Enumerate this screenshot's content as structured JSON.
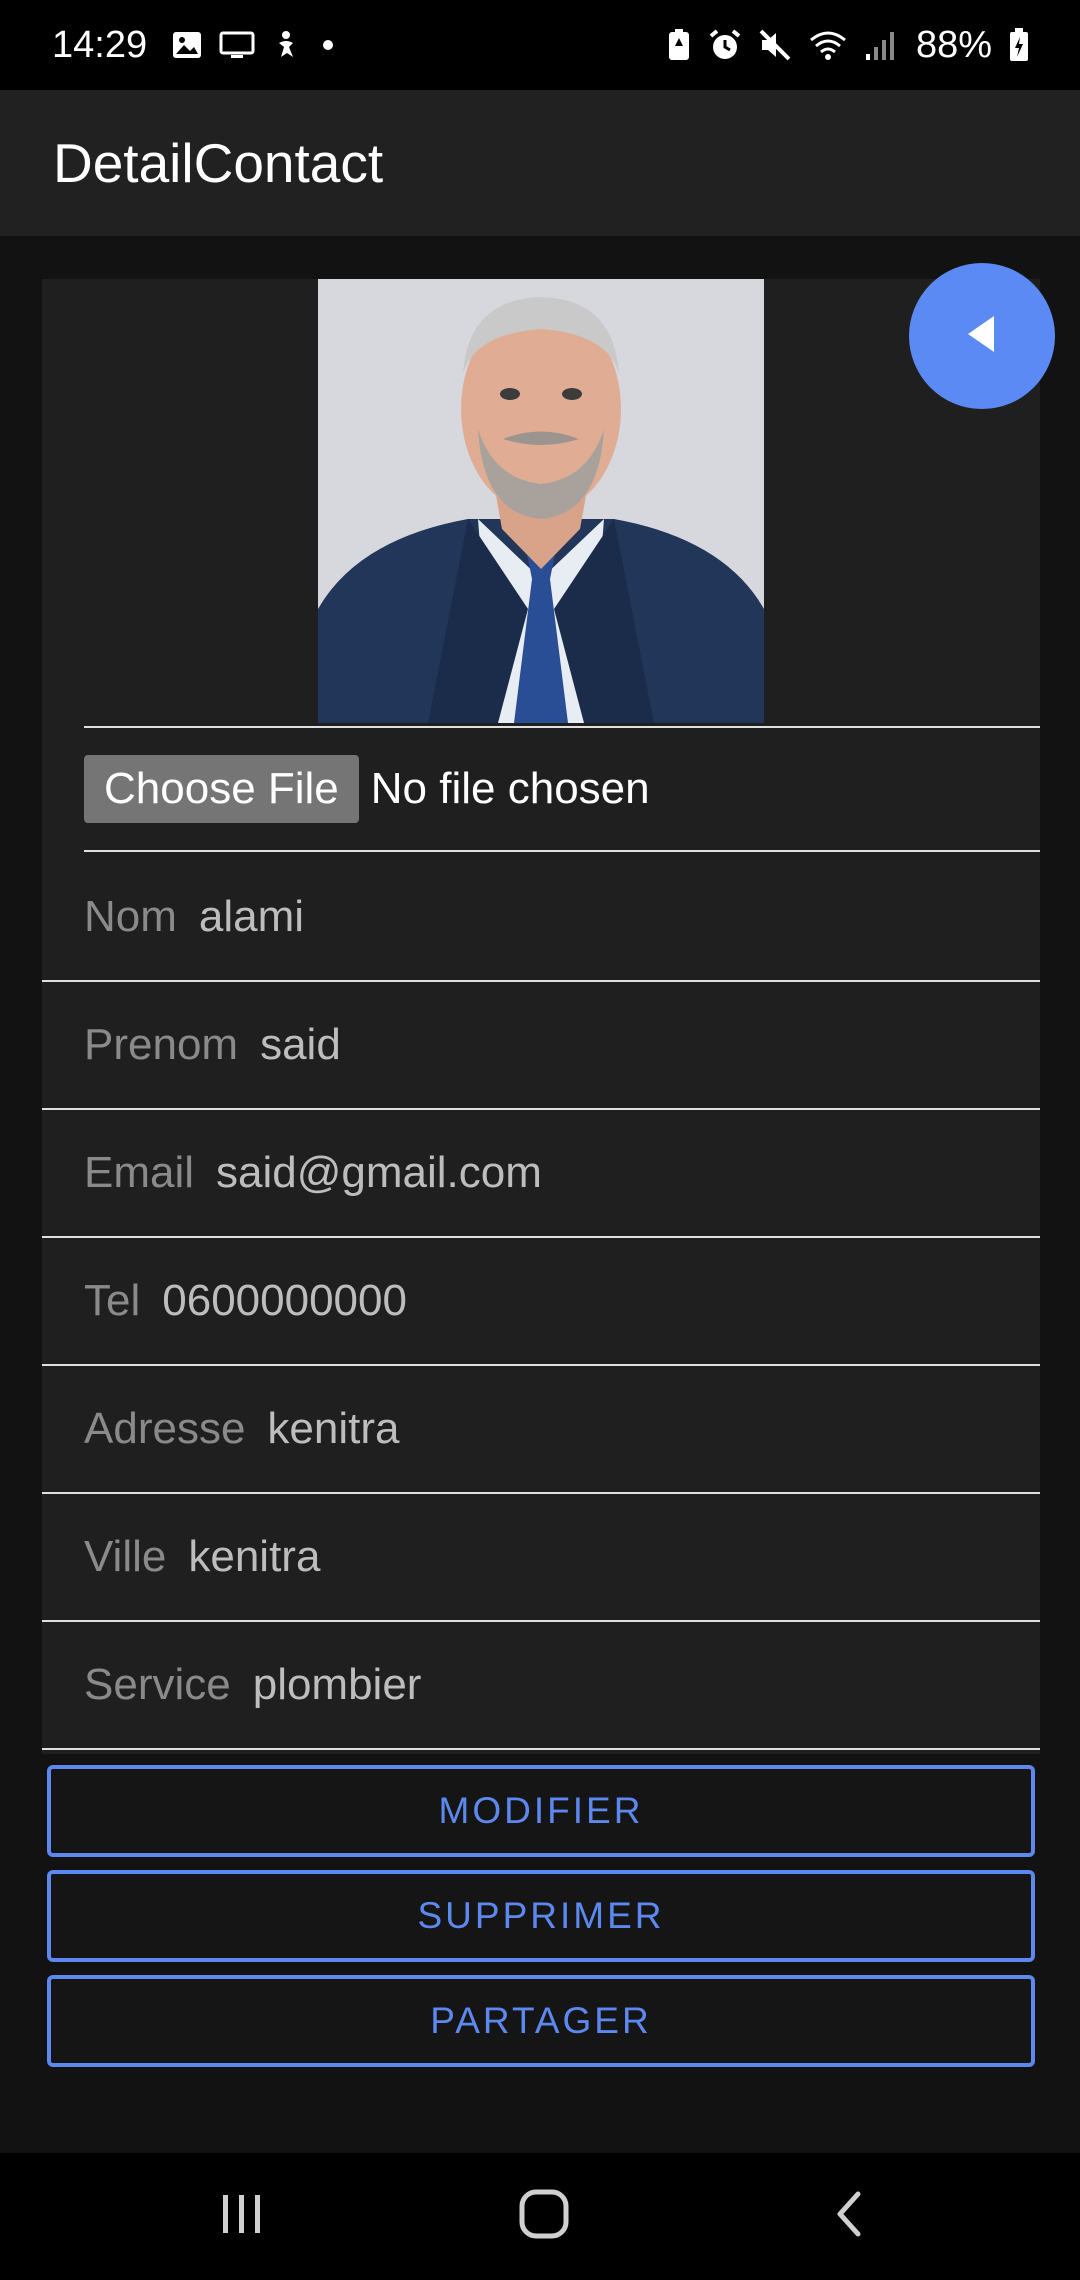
{
  "status_bar": {
    "time": "14:29",
    "battery": "88%",
    "left_icons": [
      "gallery-icon",
      "screen-cast-icon",
      "accessibility-icon",
      "notification-dot-icon"
    ],
    "right_icons": [
      "battery-saver-icon",
      "alarm-icon",
      "mute-icon",
      "wifi-icon",
      "signal-icon",
      "battery-charging-icon"
    ]
  },
  "app_bar": {
    "title": "DetailContact"
  },
  "contact": {
    "photo_icon": "contact-photo",
    "file_picker": {
      "button_label": "Choose File",
      "status": "No file chosen"
    },
    "fields": [
      {
        "label": "Nom",
        "value": "alami"
      },
      {
        "label": "Prenom",
        "value": "said"
      },
      {
        "label": "Email",
        "value": "said@gmail.com"
      },
      {
        "label": "Tel",
        "value": "0600000000"
      },
      {
        "label": "Adresse",
        "value": "kenitra"
      },
      {
        "label": "Ville",
        "value": "kenitra"
      },
      {
        "label": "Service",
        "value": "plombier"
      }
    ]
  },
  "actions": {
    "modify_label": "MODIFIER",
    "delete_label": "SUPPRIMER",
    "share_label": "PARTAGER"
  },
  "fab": {
    "icon": "back-arrow-icon"
  },
  "nav_bar": {
    "icons": [
      "recents-icon",
      "home-icon",
      "back-icon"
    ]
  },
  "colors": {
    "accent": "#5b8af5",
    "background": "#121212",
    "surface": "#1f1f1f",
    "app_bar": "#212121"
  }
}
